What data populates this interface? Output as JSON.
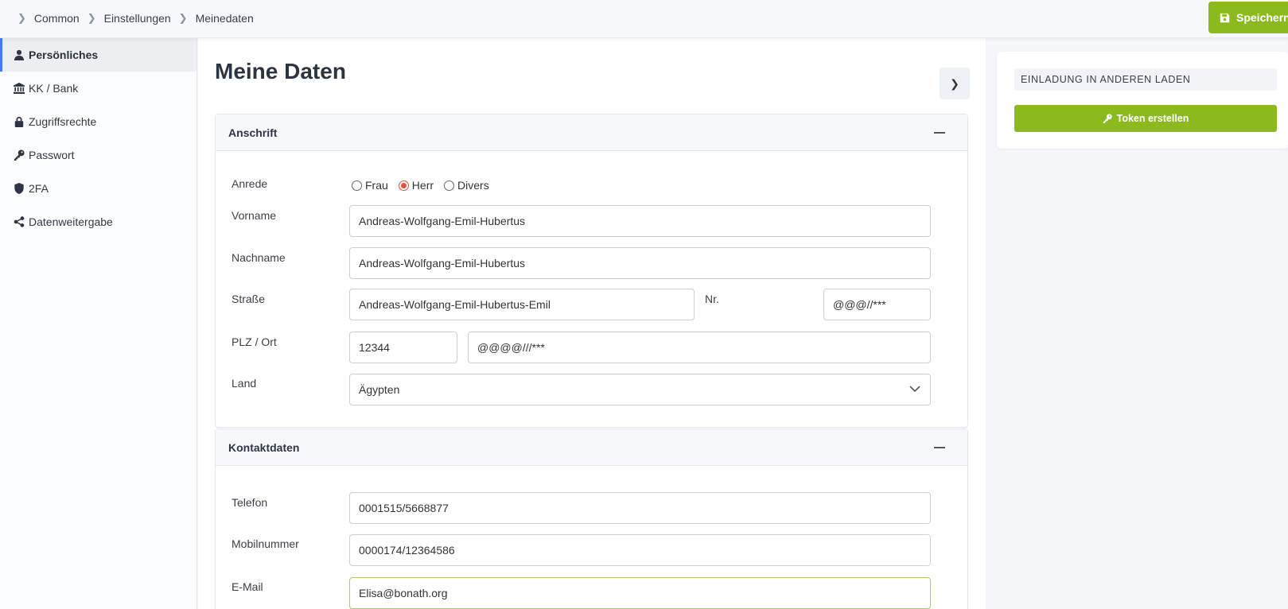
{
  "breadcrumb": [
    "Common",
    "Einstellungen",
    "Meinedaten"
  ],
  "toolbar": {
    "save_label": "Speichern"
  },
  "sidebar": {
    "items": [
      {
        "label": "Persönliches",
        "icon": "user-icon"
      },
      {
        "label": "KK / Bank",
        "icon": "bank-icon"
      },
      {
        "label": "Zugriffsrechte",
        "icon": "lock-icon"
      },
      {
        "label": "Passwort",
        "icon": "key-icon"
      },
      {
        "label": "2FA",
        "icon": "shield-icon"
      },
      {
        "label": "Datenweitergabe",
        "icon": "share-icon"
      }
    ]
  },
  "main": {
    "title": "Meine Daten",
    "address": {
      "heading": "Anschrift",
      "salutation_label": "Anrede",
      "salutation_options": [
        "Frau",
        "Herr",
        "Divers"
      ],
      "salutation_selected": "Herr",
      "firstname_label": "Vorname",
      "firstname": "Andreas-Wolfgang-Emil-Hubertus",
      "lastname_label": "Nachname",
      "lastname": "Andreas-Wolfgang-Emil-Hubertus",
      "street_label": "Straße",
      "street": "Andreas-Wolfgang-Emil-Hubertus-Emil",
      "number_label": "Nr.",
      "number": "@@@//***",
      "zip_city_label": "PLZ / Ort",
      "zip": "12344",
      "city": "@@@@///***",
      "country_label": "Land",
      "country": "Ägypten"
    },
    "contact": {
      "heading": "Kontaktdaten",
      "phone_label": "Telefon",
      "phone": "0001515/5668877",
      "mobile_label": "Mobilnummer",
      "mobile": "0000174/12364586",
      "email_label": "E-Mail",
      "email": "Elisa@bonath.org"
    }
  },
  "right": {
    "invite_heading": "EINLADUNG IN ANDEREN LADEN",
    "token_button": "Token erstellen"
  },
  "colors": {
    "accent_green": "#8cba1e",
    "active_blue": "#3e7df7",
    "radio_red": "#e0533f"
  }
}
